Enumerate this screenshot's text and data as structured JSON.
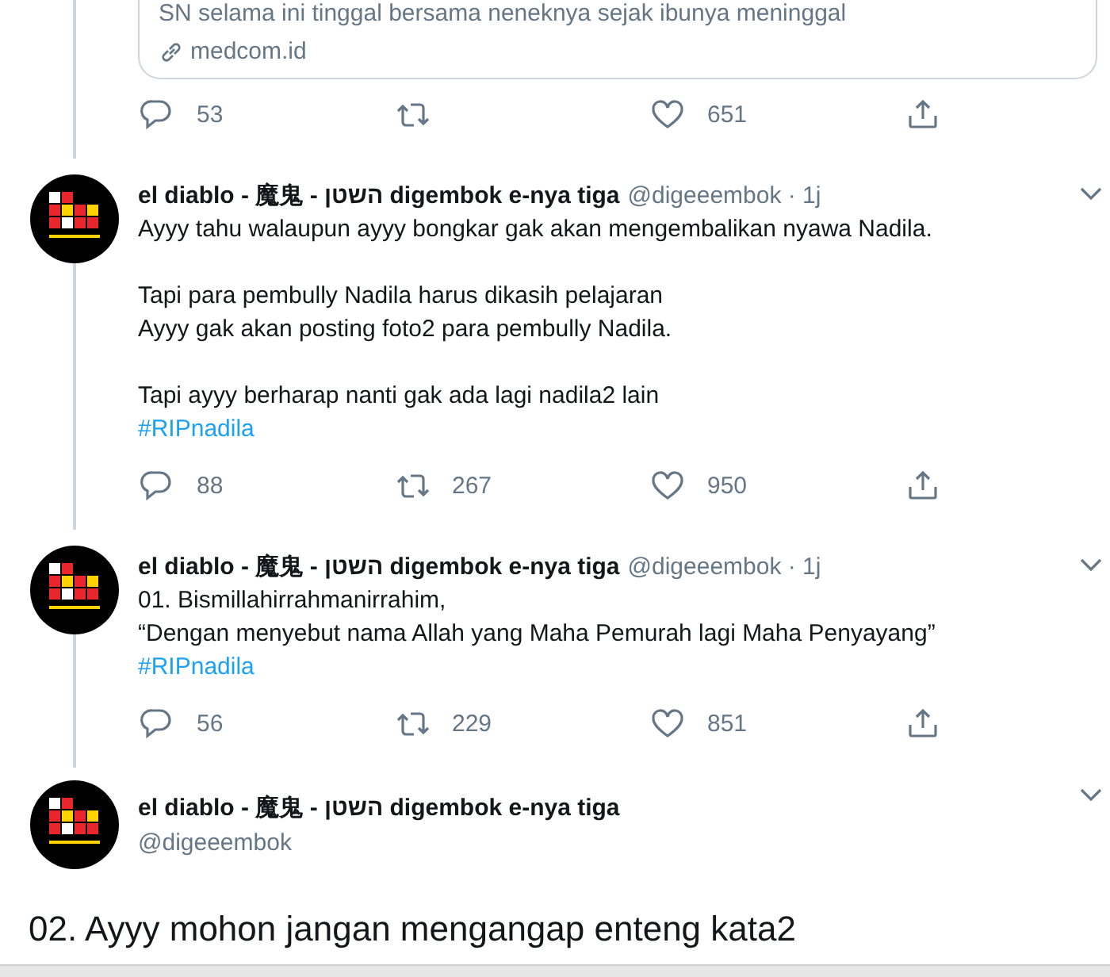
{
  "link_card": {
    "description": "SN selama ini tinggal bersama neneknya sejak ibunya meninggal",
    "domain": "medcom.id"
  },
  "card_actions": {
    "replies": "53",
    "likes": "651"
  },
  "tweets": [
    {
      "author": "el diablo - 魔鬼 - השטן digembok e-nya tiga",
      "meta": "@digeeembok · 1j",
      "body": "Ayyy tahu walaupun ayyy bongkar gak akan mengembalikan nyawa Nadila.\n\nTapi para pembully Nadila harus dikasih pelajaran\nAyyy gak akan posting foto2 para pembully Nadila.\n\nTapi ayyy berharap nanti gak ada lagi nadila2 lain",
      "hashtag": "#RIPnadila",
      "replies": "88",
      "retweets": "267",
      "likes": "950"
    },
    {
      "author": "el diablo - 魔鬼 - השטן digembok e-nya tiga",
      "meta": "@digeeembok · 1j",
      "body": "01.  Bismillahirrahmanirrahim,\n“Dengan menyebut nama Allah yang Maha Pemurah lagi Maha Penyayang”",
      "hashtag": "#RIPnadila",
      "replies": "56",
      "retweets": "229",
      "likes": "851"
    }
  ],
  "main_tweet": {
    "author": "el diablo - 魔鬼 - השטן digembok e-nya tiga",
    "handle": "@digeeembok",
    "text": "02. Ayyy mohon jangan mengangap enteng kata2"
  }
}
